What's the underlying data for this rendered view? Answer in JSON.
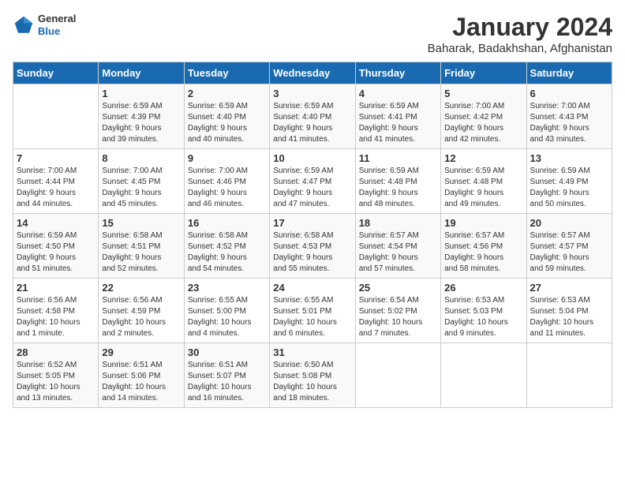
{
  "header": {
    "logo": {
      "line1": "General",
      "line2": "Blue"
    },
    "title": "January 2024",
    "location": "Baharak, Badakhshan, Afghanistan"
  },
  "days_of_week": [
    "Sunday",
    "Monday",
    "Tuesday",
    "Wednesday",
    "Thursday",
    "Friday",
    "Saturday"
  ],
  "weeks": [
    [
      {
        "day": "",
        "info": ""
      },
      {
        "day": "1",
        "info": "Sunrise: 6:59 AM\nSunset: 4:39 PM\nDaylight: 9 hours\nand 39 minutes."
      },
      {
        "day": "2",
        "info": "Sunrise: 6:59 AM\nSunset: 4:40 PM\nDaylight: 9 hours\nand 40 minutes."
      },
      {
        "day": "3",
        "info": "Sunrise: 6:59 AM\nSunset: 4:40 PM\nDaylight: 9 hours\nand 41 minutes."
      },
      {
        "day": "4",
        "info": "Sunrise: 6:59 AM\nSunset: 4:41 PM\nDaylight: 9 hours\nand 41 minutes."
      },
      {
        "day": "5",
        "info": "Sunrise: 7:00 AM\nSunset: 4:42 PM\nDaylight: 9 hours\nand 42 minutes."
      },
      {
        "day": "6",
        "info": "Sunrise: 7:00 AM\nSunset: 4:43 PM\nDaylight: 9 hours\nand 43 minutes."
      }
    ],
    [
      {
        "day": "7",
        "info": "Sunrise: 7:00 AM\nSunset: 4:44 PM\nDaylight: 9 hours\nand 44 minutes."
      },
      {
        "day": "8",
        "info": "Sunrise: 7:00 AM\nSunset: 4:45 PM\nDaylight: 9 hours\nand 45 minutes."
      },
      {
        "day": "9",
        "info": "Sunrise: 7:00 AM\nSunset: 4:46 PM\nDaylight: 9 hours\nand 46 minutes."
      },
      {
        "day": "10",
        "info": "Sunrise: 6:59 AM\nSunset: 4:47 PM\nDaylight: 9 hours\nand 47 minutes."
      },
      {
        "day": "11",
        "info": "Sunrise: 6:59 AM\nSunset: 4:48 PM\nDaylight: 9 hours\nand 48 minutes."
      },
      {
        "day": "12",
        "info": "Sunrise: 6:59 AM\nSunset: 4:48 PM\nDaylight: 9 hours\nand 49 minutes."
      },
      {
        "day": "13",
        "info": "Sunrise: 6:59 AM\nSunset: 4:49 PM\nDaylight: 9 hours\nand 50 minutes."
      }
    ],
    [
      {
        "day": "14",
        "info": "Sunrise: 6:59 AM\nSunset: 4:50 PM\nDaylight: 9 hours\nand 51 minutes."
      },
      {
        "day": "15",
        "info": "Sunrise: 6:58 AM\nSunset: 4:51 PM\nDaylight: 9 hours\nand 52 minutes."
      },
      {
        "day": "16",
        "info": "Sunrise: 6:58 AM\nSunset: 4:52 PM\nDaylight: 9 hours\nand 54 minutes."
      },
      {
        "day": "17",
        "info": "Sunrise: 6:58 AM\nSunset: 4:53 PM\nDaylight: 9 hours\nand 55 minutes."
      },
      {
        "day": "18",
        "info": "Sunrise: 6:57 AM\nSunset: 4:54 PM\nDaylight: 9 hours\nand 57 minutes."
      },
      {
        "day": "19",
        "info": "Sunrise: 6:57 AM\nSunset: 4:56 PM\nDaylight: 9 hours\nand 58 minutes."
      },
      {
        "day": "20",
        "info": "Sunrise: 6:57 AM\nSunset: 4:57 PM\nDaylight: 9 hours\nand 59 minutes."
      }
    ],
    [
      {
        "day": "21",
        "info": "Sunrise: 6:56 AM\nSunset: 4:58 PM\nDaylight: 10 hours\nand 1 minute."
      },
      {
        "day": "22",
        "info": "Sunrise: 6:56 AM\nSunset: 4:59 PM\nDaylight: 10 hours\nand 2 minutes."
      },
      {
        "day": "23",
        "info": "Sunrise: 6:55 AM\nSunset: 5:00 PM\nDaylight: 10 hours\nand 4 minutes."
      },
      {
        "day": "24",
        "info": "Sunrise: 6:55 AM\nSunset: 5:01 PM\nDaylight: 10 hours\nand 6 minutes."
      },
      {
        "day": "25",
        "info": "Sunrise: 6:54 AM\nSunset: 5:02 PM\nDaylight: 10 hours\nand 7 minutes."
      },
      {
        "day": "26",
        "info": "Sunrise: 6:53 AM\nSunset: 5:03 PM\nDaylight: 10 hours\nand 9 minutes."
      },
      {
        "day": "27",
        "info": "Sunrise: 6:53 AM\nSunset: 5:04 PM\nDaylight: 10 hours\nand 11 minutes."
      }
    ],
    [
      {
        "day": "28",
        "info": "Sunrise: 6:52 AM\nSunset: 5:05 PM\nDaylight: 10 hours\nand 13 minutes."
      },
      {
        "day": "29",
        "info": "Sunrise: 6:51 AM\nSunset: 5:06 PM\nDaylight: 10 hours\nand 14 minutes."
      },
      {
        "day": "30",
        "info": "Sunrise: 6:51 AM\nSunset: 5:07 PM\nDaylight: 10 hours\nand 16 minutes."
      },
      {
        "day": "31",
        "info": "Sunrise: 6:50 AM\nSunset: 5:08 PM\nDaylight: 10 hours\nand 18 minutes."
      },
      {
        "day": "",
        "info": ""
      },
      {
        "day": "",
        "info": ""
      },
      {
        "day": "",
        "info": ""
      }
    ]
  ]
}
